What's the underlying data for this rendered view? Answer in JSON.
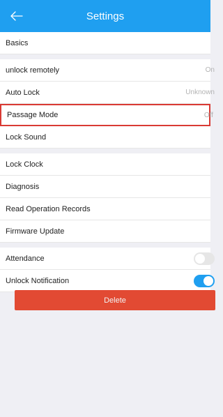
{
  "header": {
    "title": "Settings",
    "back_icon": "arrow-left-icon"
  },
  "rows": {
    "basics": "Basics",
    "unlock_remotely": {
      "label": "unlock remotely",
      "value": "On"
    },
    "auto_lock": {
      "label": "Auto Lock",
      "value": "Unknown"
    },
    "passage_mode": {
      "label": "Passage Mode",
      "value": "Off"
    },
    "lock_sound": "Lock Sound",
    "lock_clock": "Lock Clock",
    "diagnosis": "Diagnosis",
    "read_operation_records": "Read Operation Records",
    "firmware_update": "Firmware Update",
    "attendance": {
      "label": "Attendance",
      "enabled": false
    },
    "unlock_notification": {
      "label": "Unlock Notification",
      "enabled": true
    }
  },
  "delete_button": "Delete",
  "colors": {
    "header": "#1f9ff0",
    "delete": "#e24a33",
    "highlight": "#d93a34"
  }
}
